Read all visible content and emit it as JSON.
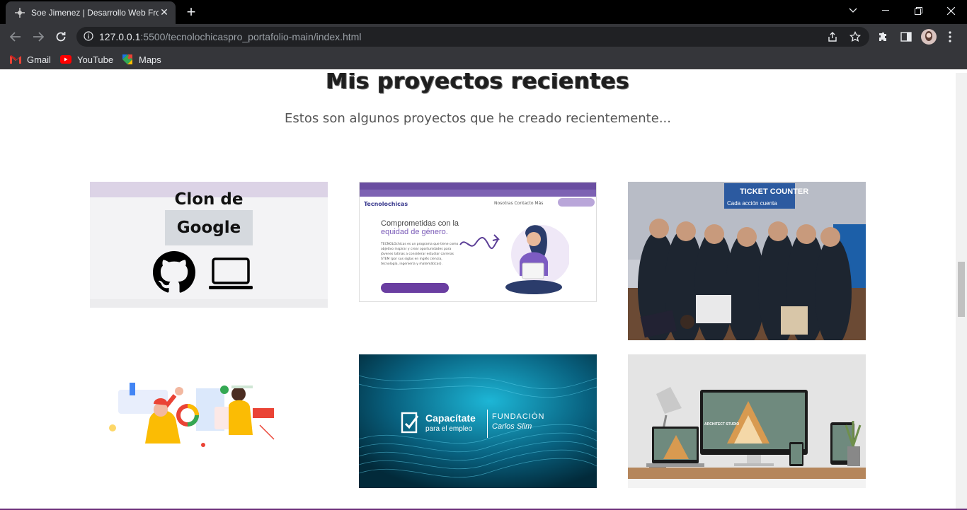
{
  "browser": {
    "tab_title": "Soe Jimenez | Desarrollo Web Fro",
    "url_host": "127.0.0.1",
    "url_rest": ":5500/tecnolochicaspro_portafolio-main/index.html",
    "bookmarks": [
      {
        "label": "Gmail"
      },
      {
        "label": "YouTube"
      },
      {
        "label": "Maps"
      }
    ]
  },
  "section": {
    "title": "Mis proyectos recientes",
    "subtitle": "Estos son algunos proyectos que he creado recientemente..."
  },
  "projects": {
    "google_clone": {
      "title_line1": "Clon de",
      "title_line2": "Google"
    },
    "tecnolochicas": {
      "brand": "Tecnolochicas",
      "menu": "Nosotras   Contacto   Más",
      "headline1": "Comprometidas con la",
      "headline2": "equidad de género.",
      "body": "TECNOLOchicas es un programa que tiene como objetivo inspirar y crear oportunidades para jóvenes latinas a considerar estudiar carreras STEM (por sus siglas en inglés ciencia, tecnología, ingeniería y matemáticas)."
    },
    "ticket_counter": {
      "sign_title": "TICKET COUNTER",
      "sign_sub": "Cada acción cuenta"
    },
    "capacitate": {
      "main": "Capacítate",
      "sub": "para el empleo",
      "found1": "FUNDACIÓN",
      "found2": "Carlos Slim"
    },
    "architect": {
      "label": "ARCHITECT STUDIO"
    }
  },
  "colors": {
    "chrome_dark": "#35363a",
    "tab_strip": "#000000",
    "accent_purple": "#6a3ea1"
  }
}
